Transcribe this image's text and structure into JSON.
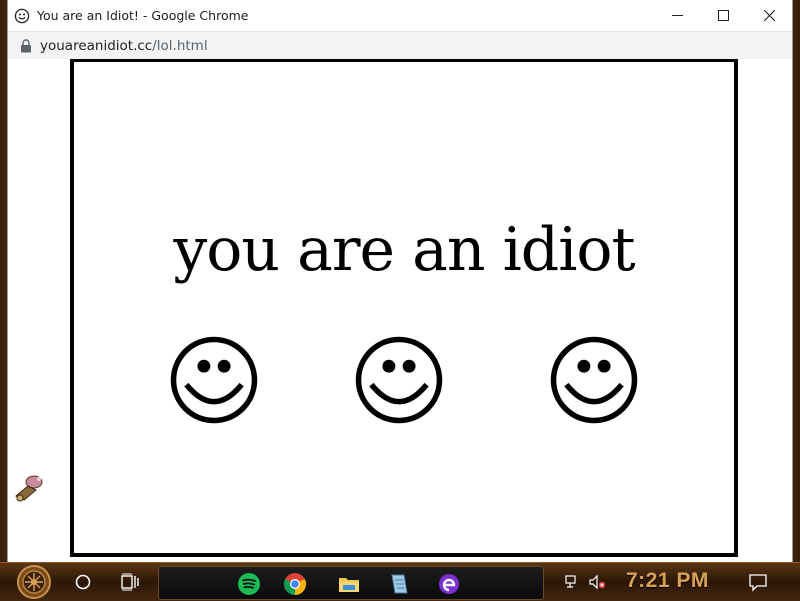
{
  "window": {
    "title": "You are an Idiot! - Google Chrome",
    "url_host": "youareanidiot.cc",
    "url_path": "/lol.html"
  },
  "page": {
    "headline": "you are an idiot",
    "smiley_count": 3
  },
  "taskbar": {
    "clock": "7:21 PM",
    "apps": [
      "spotify-icon",
      "chrome-icon",
      "file-explorer-icon",
      "notepad-icon",
      "edge-icon"
    ]
  },
  "colors": {
    "page_background": "#ffffff",
    "frame_border": "#000000",
    "clock": "#d7a256",
    "spotify": "#1db954"
  }
}
